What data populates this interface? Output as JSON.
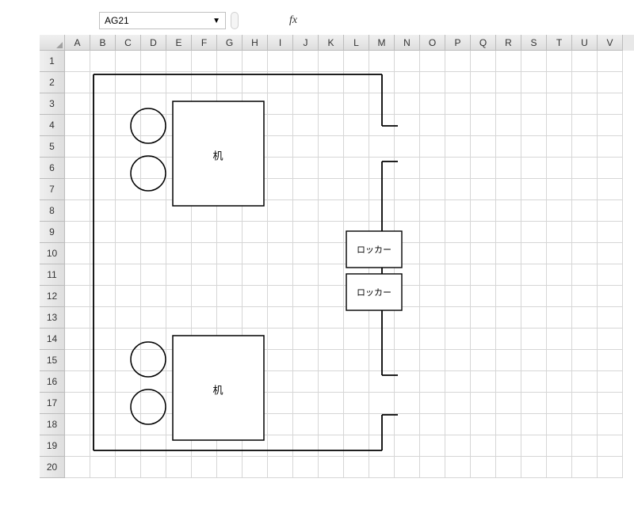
{
  "namebox": {
    "value": "AG21"
  },
  "formula_bar": {
    "fx_label": "fx",
    "value": ""
  },
  "columns": [
    "A",
    "B",
    "C",
    "D",
    "E",
    "F",
    "G",
    "H",
    "I",
    "J",
    "K",
    "L",
    "M",
    "N",
    "O",
    "P",
    "Q",
    "R",
    "S",
    "T",
    "U",
    "V"
  ],
  "rows": [
    "1",
    "2",
    "3",
    "4",
    "5",
    "6",
    "7",
    "8",
    "9",
    "10",
    "11",
    "12",
    "13",
    "14",
    "15",
    "16",
    "17",
    "18",
    "19",
    "20"
  ],
  "shapes": {
    "desk1_label": "机",
    "desk2_label": "机",
    "locker1_label": "ロッカー",
    "locker2_label": "ロッカー"
  }
}
